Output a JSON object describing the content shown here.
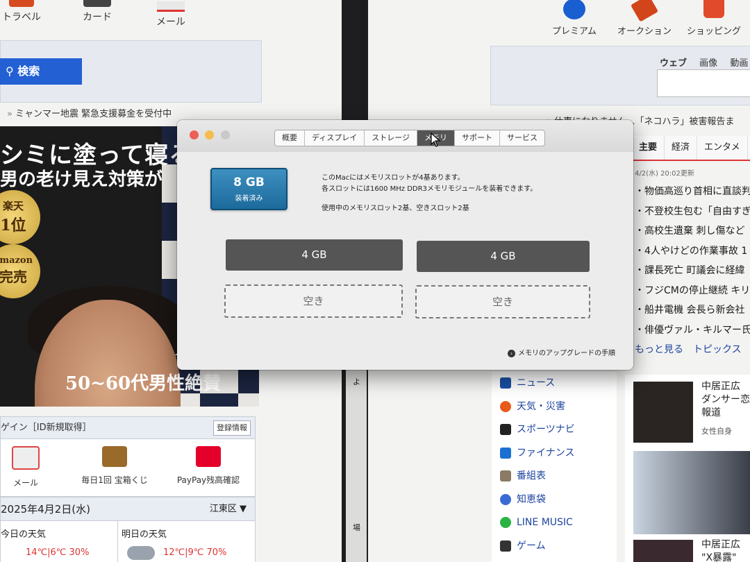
{
  "left_window": {
    "top_icons": [
      {
        "label": "トラベル",
        "icon": "suitcase-icon"
      },
      {
        "label": "カード",
        "icon": "card-icon"
      },
      {
        "label": "メール",
        "icon": "mail-icon"
      }
    ],
    "search_button": "検索",
    "news_line": "ミャンマー地震 緊急支援募金を受付中",
    "ad": {
      "headline": "シミに塗って寝る",
      "sub": "男の老け見え対策が",
      "medal1_a": "楽天",
      "medal1_b": "1位",
      "medal2_a": "amazon",
      "medal2_b": "完売",
      "bottom": "50~60代男性絶賛"
    },
    "login_bar": "ゲイン［ID新規取得］",
    "register_label": "登録情報",
    "services": [
      {
        "label": "メール"
      },
      {
        "label": "毎日1回 宝箱くじ"
      },
      {
        "label": "PayPay残高確認"
      }
    ],
    "date": "2025年4月2日(水)",
    "area": "江東区 ▼",
    "weather_today_label": "今日の天気",
    "weather_today_temp": "14℃|6℃ 30%",
    "weather_tomorrow_label": "明日の天気",
    "weather_tomorrow_temp": "12℃|9℃ 70%"
  },
  "right_window": {
    "top_icons": [
      {
        "label": "プレミアム",
        "icon": "premium-icon",
        "color": "#1a5fd1"
      },
      {
        "label": "オークション",
        "icon": "auction-hammer-icon",
        "color": "#d2441a"
      },
      {
        "label": "ショッピング",
        "icon": "shopping-cart-icon",
        "color": "#e14a2a"
      }
    ],
    "search_tabs": [
      "ウェブ",
      "画像",
      "動画"
    ],
    "headline": "仕事になりません…「ネコハラ」被害報告ま",
    "topic_tabs": [
      "主要",
      "経済",
      "エンタメ"
    ],
    "updated": "4/2(水) 20:02更新",
    "topics": [
      "物価高巡り首相に直談判",
      "不登校生包む「自由すぎ",
      "高校生遺棄 刺し傷など",
      "4人やけどの作業事故 1",
      "課長死亡 町議会に経緯",
      "フジCMの停止継続 キリ",
      "船井電機 会長ら新会社",
      "俳優ヴァル・キルマー氏"
    ],
    "more": "もっと見る",
    "topics_link": "トピックス",
    "services": [
      {
        "label": "ニュース",
        "color": "#1b4fa5"
      },
      {
        "label": "天気・災害",
        "color": "#e85a1a"
      },
      {
        "label": "スポーツナビ",
        "color": "#222"
      },
      {
        "label": "ファイナンス",
        "color": "#1b6fd0"
      },
      {
        "label": "番組表",
        "color": "#8a7a66"
      },
      {
        "label": "知恵袋",
        "color": "#3a6ad6"
      },
      {
        "label": "LINE MUSIC",
        "color": "#2ab344"
      },
      {
        "label": "ゲーム",
        "color": "#333"
      }
    ],
    "story1": "中居正広\nダンサー恋\n報道",
    "story1_source": "女性自身",
    "story2": "中居正広\n\"X暴露\"",
    "side_letters": [
      "よ",
      "場"
    ]
  },
  "dialog": {
    "tabs": [
      "概要",
      "ディスプレイ",
      "ストレージ",
      "メモリ",
      "サポート",
      "サービス"
    ],
    "active_tab": "メモリ",
    "memory_size": "8 GB",
    "memory_status": "装着済み",
    "info_line1": "このMacにはメモリスロットが4基あります。",
    "info_line2": "各スロットには1600 MHz DDR3メモリモジュールを装着できます。",
    "info_line3": "使用中のメモリスロット2基、空きスロット2基",
    "slots": [
      {
        "label": "4 GB",
        "filled": true
      },
      {
        "label": "4 GB",
        "filled": true
      },
      {
        "label": "空き",
        "filled": false
      },
      {
        "label": "空き",
        "filled": false
      }
    ],
    "upgrade_link": "メモリのアップグレードの手順",
    "colors": {
      "badge": "#2a7db0",
      "slot_filled": "#555555",
      "close": "#ec5f57",
      "minimize": "#f5bd4f",
      "zoom": "#c9c9c9"
    }
  }
}
